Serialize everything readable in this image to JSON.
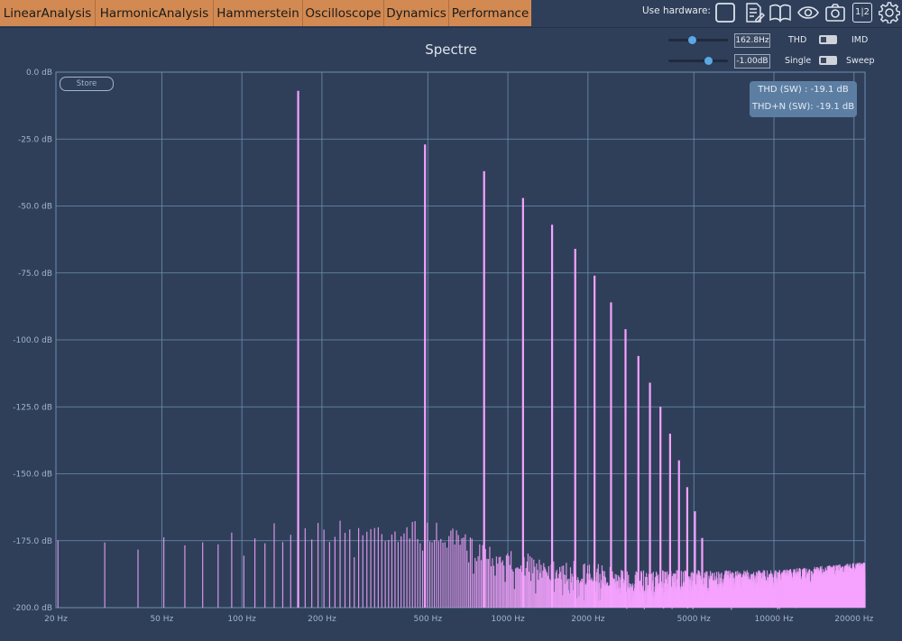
{
  "tabs": [
    "LinearAnalysis",
    "HarmonicAnalysis",
    "Hammerstein",
    "Oscilloscope",
    "Dynamics",
    "Performance"
  ],
  "toolbar": {
    "hardware_label": "Use hardware:",
    "icons": [
      "hardware-checkbox-icon",
      "notes-icon",
      "book-icon",
      "eye-icon",
      "camera-icon",
      "channel-split-icon",
      "gear-icon"
    ],
    "channel_label": "1|2"
  },
  "plot": {
    "title": "Spectre",
    "store_label": "Store"
  },
  "controls": {
    "frequency": {
      "value": "162.8Hz",
      "level": 0.38
    },
    "amplitude": {
      "value": "-1.00dB",
      "level": 0.7
    },
    "mode_left": "THD",
    "mode_right": "IMD",
    "run_left": "Single",
    "run_right": "Sweep"
  },
  "results": {
    "thd": "THD (SW) : -19.1 dB",
    "thdn": "THD+N (SW): -19.1 dB"
  },
  "colors": {
    "background": "#2f3f5a",
    "spectrum": "#f6a3ff",
    "tab": "#d28a52",
    "grid": "#6e8fb0"
  },
  "chart_data": {
    "type": "line",
    "title": "Spectre",
    "x_scale": "log",
    "xlim": [
      20,
      22000
    ],
    "ylim": [
      -200,
      0
    ],
    "x_ticks": [
      20,
      50,
      100,
      200,
      500,
      1000,
      2000,
      5000,
      10000,
      20000
    ],
    "x_tick_labels": [
      "20 Hz",
      "50 Hz",
      "100 Hz",
      "200 Hz",
      "500 Hz",
      "1000 Hz",
      "2000 Hz",
      "5000 Hz",
      "10000 Hz",
      "20000 Hz"
    ],
    "y_ticks": [
      0,
      -25,
      -50,
      -75,
      -100,
      -125,
      -150,
      -175,
      -200
    ],
    "y_tick_labels": [
      "0.0 dB",
      "-25.0 dB",
      "-50.0 dB",
      "-75.0 dB",
      "-100.0 dB",
      "-125.0 dB",
      "-150.0 dB",
      "-175.0 dB",
      "-200.0 dB"
    ],
    "grid": true,
    "peaks": [
      {
        "x": 162.8,
        "y": -7
      },
      {
        "x": 488,
        "y": -27
      },
      {
        "x": 814,
        "y": -37
      },
      {
        "x": 1140,
        "y": -47
      },
      {
        "x": 1466,
        "y": -57
      },
      {
        "x": 1791,
        "y": -66
      },
      {
        "x": 2117,
        "y": -76
      },
      {
        "x": 2442,
        "y": -86
      },
      {
        "x": 2768,
        "y": -96
      },
      {
        "x": 3094,
        "y": -106
      },
      {
        "x": 3420,
        "y": -116
      },
      {
        "x": 3745,
        "y": -125
      },
      {
        "x": 4071,
        "y": -135
      },
      {
        "x": 4397,
        "y": -145
      },
      {
        "x": 4723,
        "y": -155
      },
      {
        "x": 5048,
        "y": -164
      },
      {
        "x": 5374,
        "y": -174
      }
    ],
    "noise_floor": [
      {
        "x": 20,
        "y": -175
      },
      {
        "x": 60,
        "y": -170
      },
      {
        "x": 150,
        "y": -167
      },
      {
        "x": 500,
        "y": -167
      },
      {
        "x": 1000,
        "y": -178
      },
      {
        "x": 3000,
        "y": -186
      },
      {
        "x": 10000,
        "y": -186
      },
      {
        "x": 22000,
        "y": -183
      }
    ]
  }
}
